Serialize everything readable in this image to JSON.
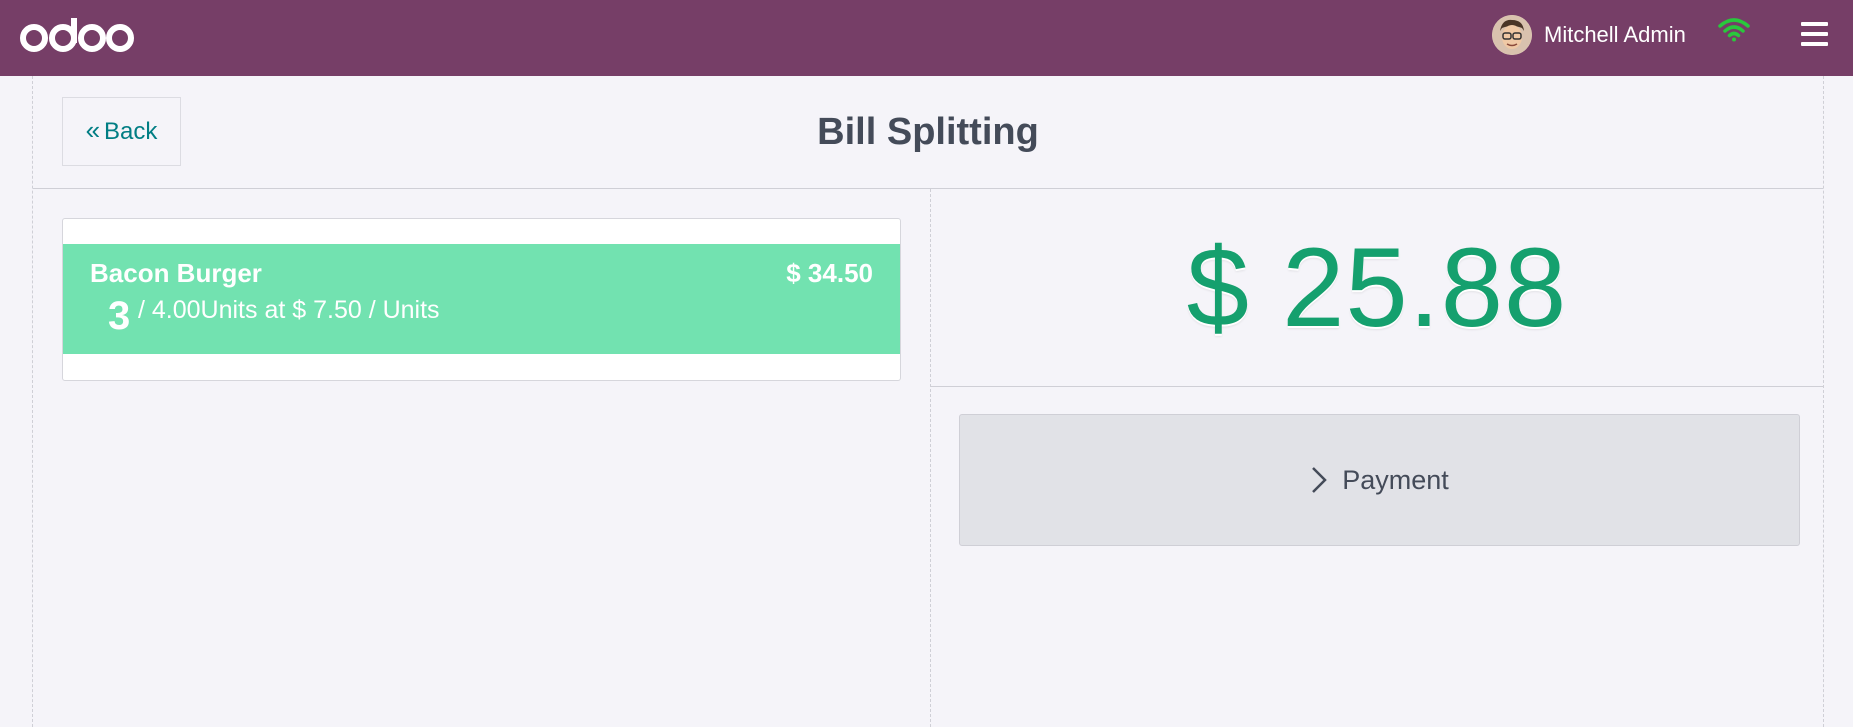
{
  "app": {
    "logo_text": "odoo"
  },
  "topbar": {
    "user_name": "Mitchell Admin",
    "user_icon": "avatar",
    "connection_icon": "wifi-icon",
    "menu_icon": "hamburger-menu-icon",
    "colors": {
      "bar": "#763e67",
      "wifi": "#28c83c"
    }
  },
  "header": {
    "back_label": "Back",
    "title": "Bill Splitting"
  },
  "orderlines": [
    {
      "product": "Bacon Burger",
      "price": "$ 34.50",
      "selected_qty": "3",
      "info": "/ 4.00Units at $ 7.50 / Units"
    }
  ],
  "summary": {
    "amount": "$ 25.88",
    "payment_label": "Payment"
  },
  "colors": {
    "selected_line": "#72e2b0",
    "amount": "#15a06e",
    "accent": "#017e84"
  }
}
